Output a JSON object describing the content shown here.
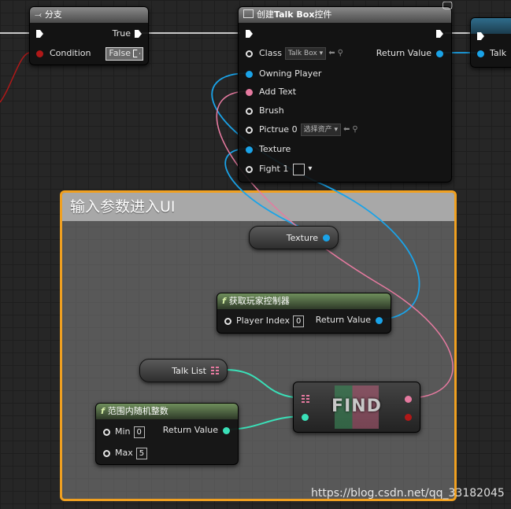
{
  "branch_node": {
    "title": "分支",
    "true_label": "True",
    "condition_label": "Condition",
    "false_label": "False"
  },
  "create_widget_node": {
    "title_prefix": "创建",
    "title_bold": "Talk Box",
    "title_suffix": "控件",
    "class_label": "Class",
    "class_value": "Talk Box",
    "return_label": "Return Value",
    "owning_player_label": "Owning Player",
    "add_text_label": "Add Text",
    "brush_label": "Brush",
    "pictrue_label": "Pictrue 0",
    "pictrue_value": "选择资产",
    "texture_label": "Texture",
    "fight_label": "Fight 1"
  },
  "next_node": {
    "title": "Talk"
  },
  "comment": {
    "title": "输入参数进入UI"
  },
  "texture_var": {
    "label": "Texture"
  },
  "get_player_controller": {
    "title": "获取玩家控制器",
    "player_index_label": "Player Index",
    "player_index_value": "0",
    "return_label": "Return Value"
  },
  "talk_list_var": {
    "label": "Talk List"
  },
  "random_int_node": {
    "title": "范围内随机整数",
    "min_label": "Min",
    "min_value": "0",
    "max_label": "Max",
    "max_value": "5",
    "return_label": "Return Value"
  },
  "find_node": {
    "label": "FIND"
  },
  "watermark": "https://blog.csdn.net/qq_33182045",
  "colors": {
    "comment_border": "#f0a020",
    "object_pin": "#1aa3e8",
    "string_pin": "#e67aa0",
    "int_pin": "#3ae0b8",
    "bool_pin": "#b01818"
  }
}
